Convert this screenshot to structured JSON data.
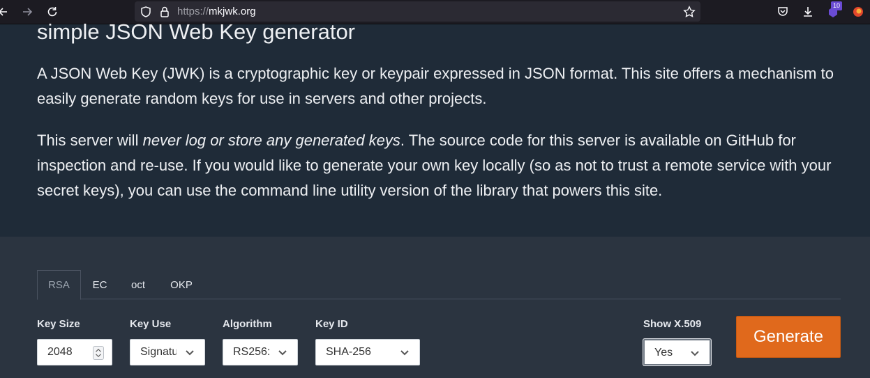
{
  "browser": {
    "url_scheme": "https://",
    "url_host": "mkjwk.org",
    "extension_badge": "10"
  },
  "hero": {
    "title": "simple JSON Web Key generator",
    "para1": "A JSON Web Key (JWK) is a cryptographic key or keypair expressed in JSON format. This site offers a mechanism to easily generate random keys for use in servers and other projects.",
    "para2_before": "This server will ",
    "para2_emphasis": "never log or store any generated keys",
    "para2_after": ". The source code for this server is available on GitHub for inspection and re-use. If you would like to generate your own key locally (so as not to trust a remote service with your secret keys), you can use the command line utility version of the library that powers this site."
  },
  "tabs": [
    {
      "label": "RSA",
      "active": true
    },
    {
      "label": "EC",
      "active": false
    },
    {
      "label": "oct",
      "active": false
    },
    {
      "label": "OKP",
      "active": false
    }
  ],
  "form": {
    "key_size": {
      "label": "Key Size",
      "value": "2048"
    },
    "key_use": {
      "label": "Key Use",
      "value": "Signatu"
    },
    "algorithm": {
      "label": "Algorithm",
      "value": "RS256:"
    },
    "key_id": {
      "label": "Key ID",
      "value": "SHA-256"
    },
    "show_x509": {
      "label": "Show X.509",
      "value": "Yes"
    },
    "generate_label": "Generate"
  },
  "colors": {
    "accent": "#e0691c",
    "hero_bg": "#1f2b38",
    "form_bg": "#2b3440"
  }
}
